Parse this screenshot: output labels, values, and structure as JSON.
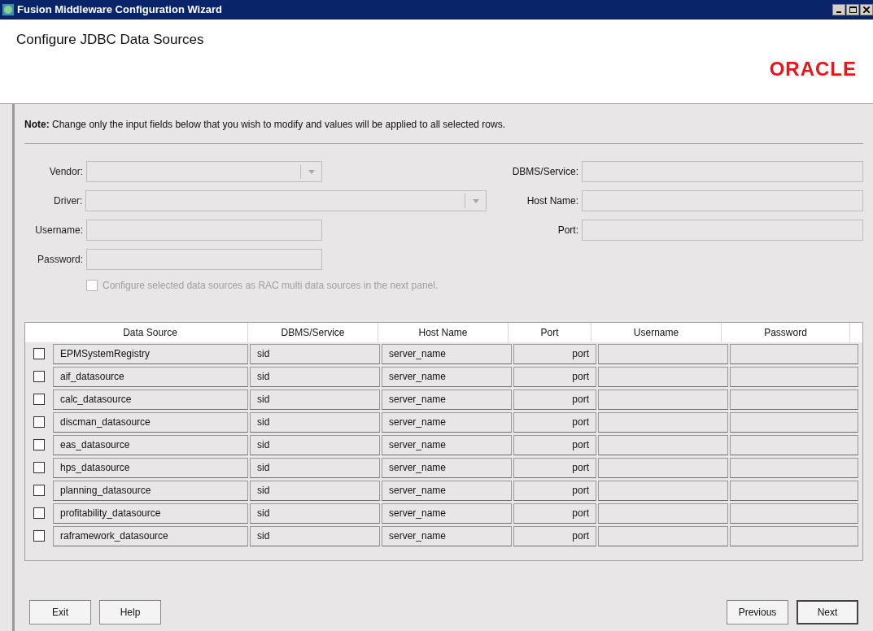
{
  "window": {
    "title": "Fusion Middleware Configuration Wizard"
  },
  "header": {
    "title": "Configure JDBC Data Sources",
    "logo": "ORACLE"
  },
  "note": "**Note:**  Change only the input fields below that you wish to modify and values will be applied to all selected rows.",
  "form_left": [
    {
      "label": "Vendor:",
      "kind": "dropdown",
      "disabled": true
    },
    {
      "label": "Driver:",
      "kind": "dropdown",
      "disabled": true
    },
    {
      "label": "Username:",
      "kind": "text",
      "disabled": true
    },
    {
      "label": "Password:",
      "kind": "text",
      "disabled": true
    }
  ],
  "form_right": [
    {
      "label": "DBMS/Service:",
      "disabled": true
    },
    {
      "label": "Host Name:",
      "disabled": true
    },
    {
      "label": "Port:",
      "disabled": true
    }
  ],
  "rac_option": {
    "label": "Configure selected data sources as RAC multi data sources in the next panel.",
    "checked": false,
    "disabled": true
  },
  "table": {
    "columns": [
      "Data Source",
      "DBMS/Service",
      "Host Name",
      "Port",
      "Username",
      "Password"
    ],
    "rows": [
      {
        "selected": false,
        "cells": [
          "EPMSystemRegistry",
          "sid",
          "server_name",
          "port",
          "",
          ""
        ]
      },
      {
        "selected": false,
        "cells": [
          "aif_datasource",
          "sid",
          "server_name",
          "port",
          "",
          ""
        ]
      },
      {
        "selected": false,
        "cells": [
          "calc_datasource",
          "sid",
          "server_name",
          "port",
          "",
          ""
        ]
      },
      {
        "selected": false,
        "cells": [
          "discman_datasource",
          "sid",
          "server_name",
          "port",
          "",
          ""
        ]
      },
      {
        "selected": false,
        "cells": [
          "eas_datasource",
          "sid",
          "server_name",
          "port",
          "",
          ""
        ]
      },
      {
        "selected": false,
        "cells": [
          "hps_datasource",
          "sid",
          "server_name",
          "port",
          "",
          ""
        ]
      },
      {
        "selected": false,
        "cells": [
          "planning_datasource",
          "sid",
          "server_name",
          "port",
          "",
          ""
        ]
      },
      {
        "selected": false,
        "cells": [
          "profitability_datasource",
          "sid",
          "server_name",
          "port",
          "",
          ""
        ]
      },
      {
        "selected": false,
        "cells": [
          "raframework_datasource",
          "sid",
          "server_name",
          "port",
          "",
          ""
        ]
      }
    ]
  },
  "buttons_left": [
    {
      "label": "Exit",
      "default": false
    },
    {
      "label": "Help",
      "default": false
    }
  ],
  "buttons_right": [
    {
      "label": "Previous",
      "default": false
    },
    {
      "label": "Next",
      "default": true
    }
  ]
}
